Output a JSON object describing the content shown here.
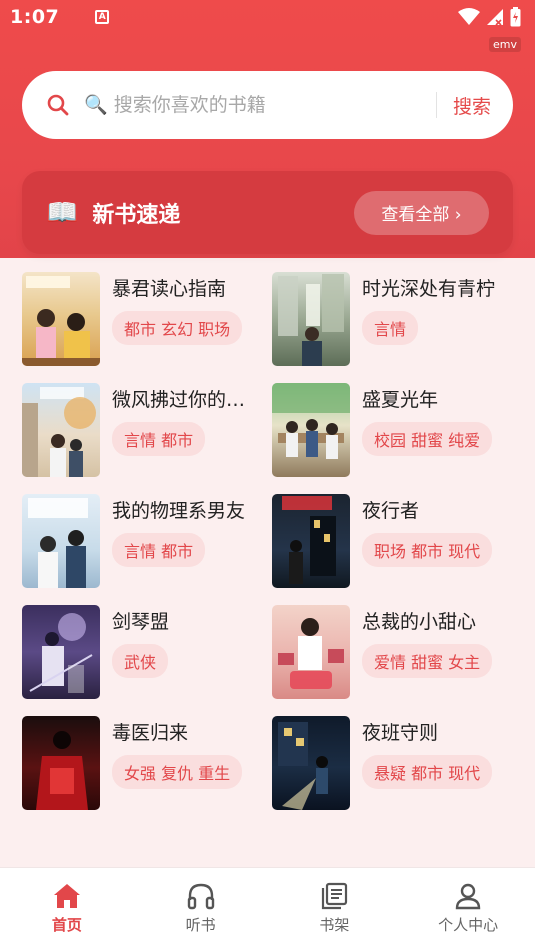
{
  "status_bar": {
    "time": "1:07",
    "notification_icon": "A",
    "emv_label": "emv"
  },
  "search": {
    "placeholder": "🔍 搜索你喜欢的书籍",
    "button_label": "搜索"
  },
  "banner": {
    "icon": "📖",
    "title": "新书速递",
    "view_all_label": "查看全部 ›"
  },
  "books": [
    {
      "title": "暴君读心指南",
      "tags": "都市 玄幻 职场"
    },
    {
      "title": "时光深处有青柠",
      "tags": "言情"
    },
    {
      "title": "微风拂过你的…",
      "tags": "言情 都市"
    },
    {
      "title": "盛夏光年",
      "tags": "校园 甜蜜 纯爱"
    },
    {
      "title": "我的物理系男友",
      "tags": "言情 都市"
    },
    {
      "title": "夜行者",
      "tags": "职场 都市 现代"
    },
    {
      "title": "剑琴盟",
      "tags": "武侠"
    },
    {
      "title": "总裁的小甜心",
      "tags": "爱情 甜蜜 女主"
    },
    {
      "title": "毒医归来",
      "tags": "女强 复仇 重生"
    },
    {
      "title": "夜班守则",
      "tags": "悬疑 都市 现代"
    }
  ],
  "tabs": [
    {
      "label": "首页",
      "icon": "home-icon",
      "active": true
    },
    {
      "label": "听书",
      "icon": "headphones-icon",
      "active": false
    },
    {
      "label": "书架",
      "icon": "bookshelf-icon",
      "active": false
    },
    {
      "label": "个人中心",
      "icon": "person-icon",
      "active": false
    }
  ],
  "colors": {
    "accent": "#e2474a",
    "header": "#ef4b4b",
    "banner": "#d53b40",
    "tag_bg": "#fadede",
    "page_bg": "#fcefef"
  }
}
